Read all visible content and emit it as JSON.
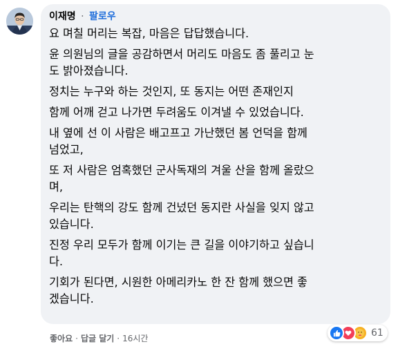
{
  "comment": {
    "author": "이재명",
    "separator": "·",
    "follow_label": "팔로우",
    "paragraphs": [
      "요 며칠 머리는 복잡, 마음은 답답했습니다.",
      "윤 의원님의 글을 공감하면서 머리도 마음도 좀 풀리고 눈\n도 밝아졌습니다.",
      "정치는 누구와 하는 것인지, 또 동지는 어떤 존재인지",
      "함께 어깨 걷고 나가면 두려움도 이겨낼 수 있었습니다.",
      "내 옆에 선 이 사람은 배고프고 가난했던 봄 언덕을 함께\n넘었고,",
      "또 저 사람은 엄혹했던 군사독재의 겨울 산을 함께 올랐으\n며,",
      "우리는 탄핵의 강도 함께 건넜던 동지란 사실을 잊지 않고\n있습니다.",
      "진정 우리 모두가 함께 이기는 큰 길을 이야기하고 싶습니\n다.",
      "기회가 된다면, 시원한 아메리카노 한 잔 함께 했으면 좋\n겠습니다."
    ]
  },
  "actions": {
    "like_label": "좋아요",
    "reply_label": "답글 달기",
    "separator": "·",
    "time": "16시간"
  },
  "reactions": {
    "icons": [
      "like-icon",
      "love-icon",
      "care-icon"
    ],
    "count": "61",
    "colors": {
      "like": "#1877f2",
      "love": "#f33e58",
      "care": "#f7b125"
    }
  },
  "colors": {
    "bubble_bg": "#f0f2f5",
    "text": "#050505",
    "muted": "#65676b",
    "follow": "#216fdb"
  }
}
